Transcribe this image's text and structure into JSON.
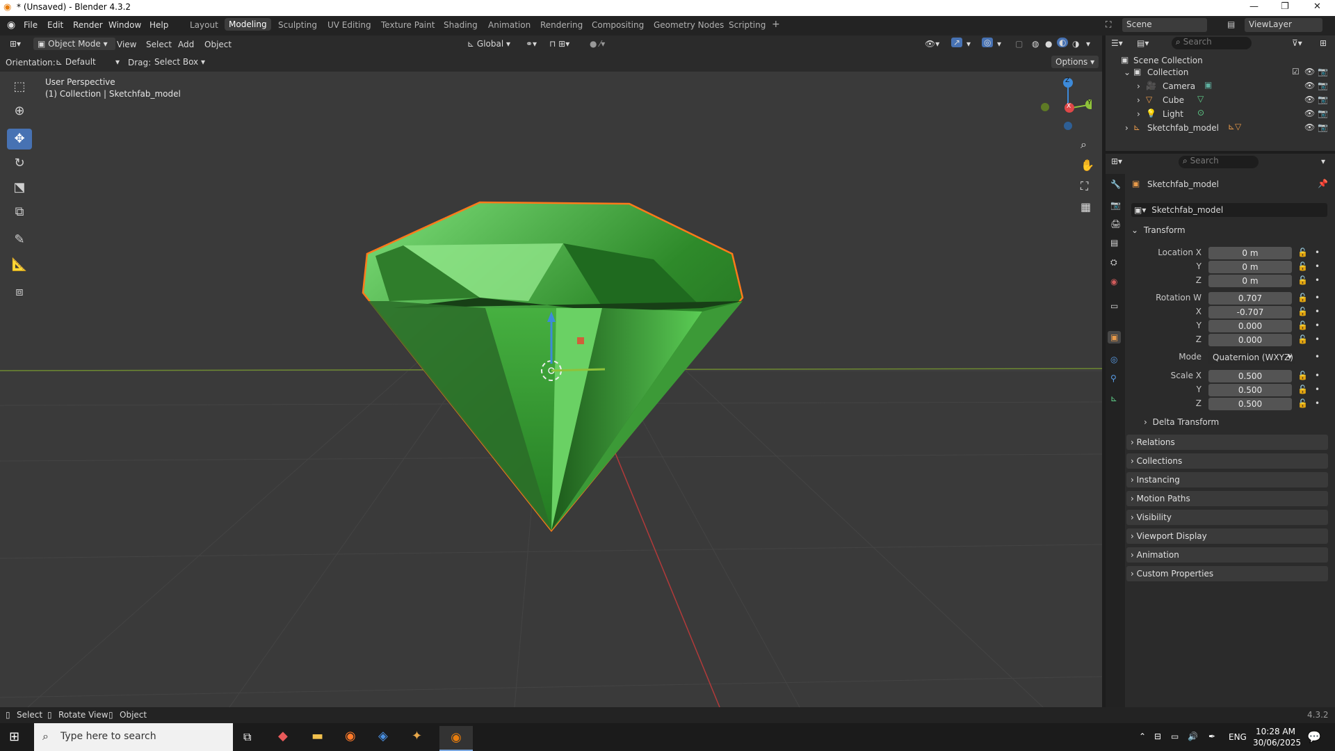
{
  "window": {
    "title": "* (Unsaved) - Blender 4.3.2"
  },
  "menu": [
    "File",
    "Edit",
    "Render",
    "Window",
    "Help"
  ],
  "workspaces": [
    "Layout",
    "Modeling",
    "Sculpting",
    "UV Editing",
    "Texture Paint",
    "Shading",
    "Animation",
    "Rendering",
    "Compositing",
    "Geometry Nodes",
    "Scripting"
  ],
  "active_workspace": "Modeling",
  "scene": {
    "name": "Scene",
    "view_layer": "ViewLayer"
  },
  "header": {
    "mode": "Object Mode",
    "view": "View",
    "select": "Select",
    "add": "Add",
    "object": "Object",
    "transform_orientation": "Global",
    "orientation_label": "Orientation:",
    "orientation_value": "Default",
    "drag_label": "Drag:",
    "drag_value": "Select Box",
    "options": "Options"
  },
  "viewport": {
    "perspective": "User Perspective",
    "collection_info": "(1) Collection | Sketchfab_model",
    "gizmo_axes": {
      "x": "X",
      "y": "Y",
      "z": "Z"
    }
  },
  "outliner": {
    "search_placeholder": "Search",
    "root": "Scene Collection",
    "collection": "Collection",
    "items": [
      "Camera",
      "Cube",
      "Light"
    ],
    "model": "Sketchfab_model"
  },
  "properties": {
    "search_placeholder": "Search",
    "object_name": "Sketchfab_model",
    "datablock": "Sketchfab_model",
    "transform_title": "Transform",
    "location_label": "Location X",
    "location": [
      "0 m",
      "0 m",
      "0 m"
    ],
    "rotation_label": "Rotation W",
    "rotation": [
      "0.707",
      "-0.707",
      "0.000",
      "0.000"
    ],
    "mode_label": "Mode",
    "mode_value": "Quaternion (WXYZ)",
    "scale_label": "Scale X",
    "scale": [
      "0.500",
      "0.500",
      "0.500"
    ],
    "axis_y": "Y",
    "axis_z": "Z",
    "axis_x": "X",
    "delta": "Delta Transform",
    "sections": [
      "Relations",
      "Collections",
      "Instancing",
      "Motion Paths",
      "Visibility",
      "Viewport Display",
      "Animation",
      "Custom Properties"
    ]
  },
  "status": {
    "select": "Select",
    "rotate": "Rotate View",
    "object": "Object",
    "version": "4.3.2"
  },
  "taskbar": {
    "search_placeholder": "Type here to search",
    "language": "ENG",
    "time": "10:28 AM",
    "date": "30/06/2025"
  }
}
